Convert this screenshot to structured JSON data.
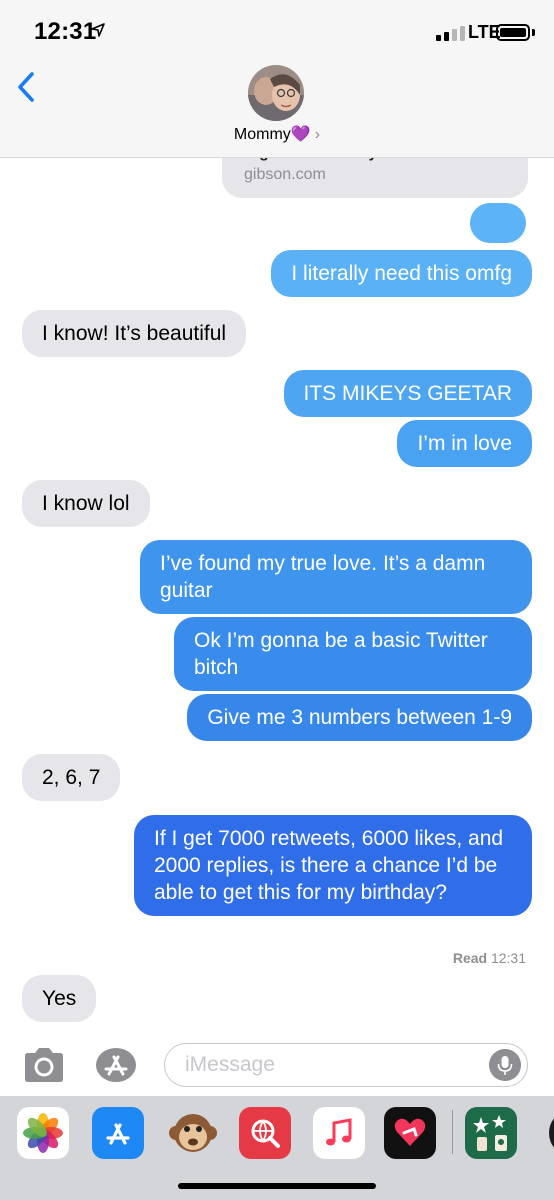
{
  "status_bar": {
    "time": "12:31",
    "network": "LTE"
  },
  "header": {
    "contact_name": "Mommy💜",
    "chevron": "›"
  },
  "link_preview": {
    "title": "Signature Melody Maker",
    "domain": "gibson.com"
  },
  "messages": [
    {
      "sender": "me",
      "text": ""
    },
    {
      "sender": "me",
      "text": "I literally need this omfg"
    },
    {
      "sender": "them",
      "text": "I know! It’s beautiful"
    },
    {
      "sender": "me",
      "text": "ITS MIKEYS GEETAR"
    },
    {
      "sender": "me",
      "text": "I’m in love"
    },
    {
      "sender": "them",
      "text": "I know lol"
    },
    {
      "sender": "me",
      "text": "I’ve found my true love. It’s a damn guitar"
    },
    {
      "sender": "me",
      "text": "Ok I’m gonna be a basic Twitter bitch"
    },
    {
      "sender": "me",
      "text": "Give me 3 numbers between 1-9"
    },
    {
      "sender": "them",
      "text": "2, 6, 7"
    },
    {
      "sender": "me",
      "text": "If I get 7000 retweets, 6000 likes, and 2000 replies, is there a chance I’d be able to get this for my birthday?"
    },
    {
      "sender": "them",
      "text": "Yes"
    }
  ],
  "read_receipt": {
    "label": "Read",
    "time": "12:31"
  },
  "input": {
    "placeholder": "iMessage"
  },
  "app_drawer": [
    "photos-app-icon",
    "app-store-app-icon",
    "animoji-app-icon",
    "images-search-app-icon",
    "music-app-icon",
    "digital-touch-app-icon",
    "starbucks-sticker-app-icon",
    "penguin-sticker-app-icon"
  ],
  "colors": {
    "outgoing_top": "#5cb3f7",
    "outgoing_bottom": "#2f6ee8",
    "incoming": "#e5e5ea",
    "ios_blue": "#1a7cf5"
  }
}
